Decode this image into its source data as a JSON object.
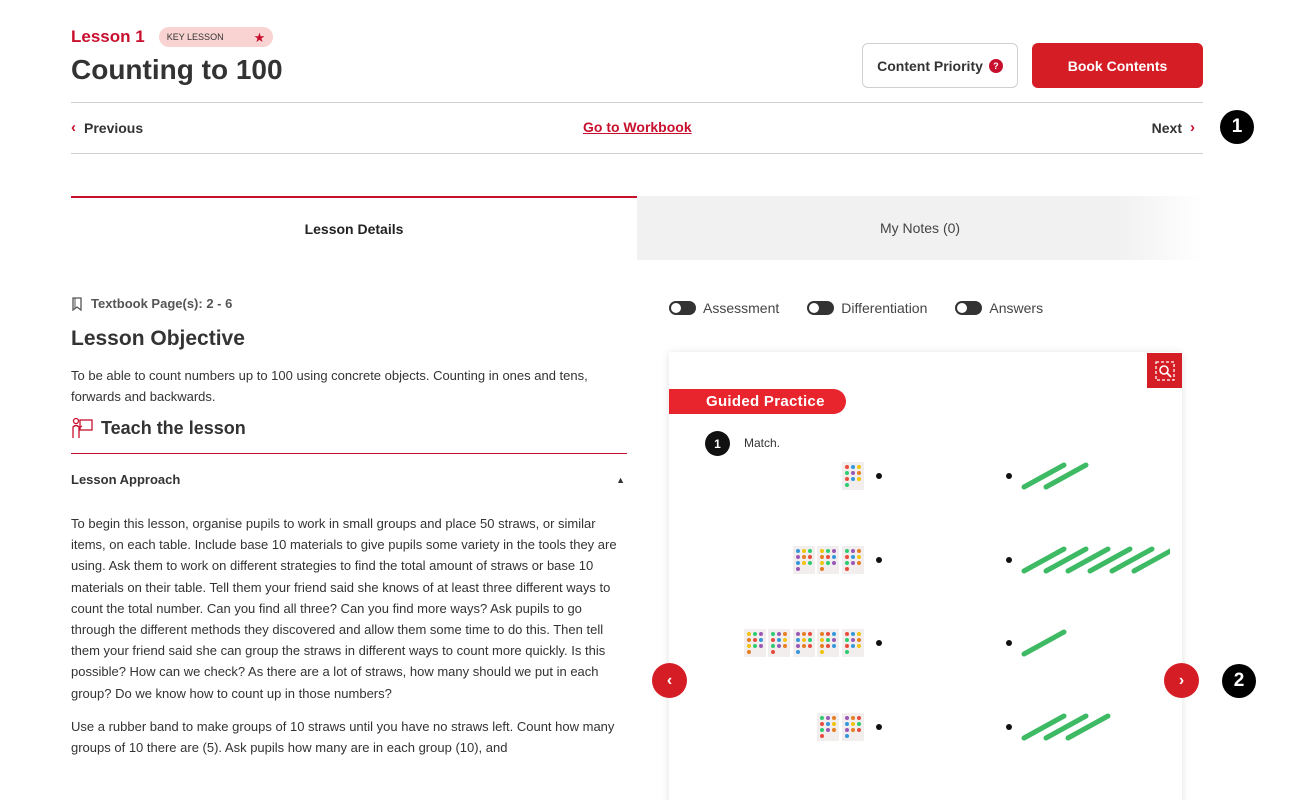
{
  "header": {
    "lesson_label": "Lesson 1",
    "badge_label": "KEY LESSON",
    "title": "Counting to 100",
    "content_priority_label": "Content Priority",
    "book_contents_label": "Book Contents"
  },
  "nav": {
    "previous_label": "Previous",
    "workbook_label": "Go to Workbook",
    "next_label": "Next"
  },
  "callouts": [
    "1",
    "2"
  ],
  "tabs": [
    {
      "label": "Lesson Details",
      "active": true
    },
    {
      "label": "My Notes (0)",
      "active": false
    }
  ],
  "details": {
    "textbook_pages": "Textbook Page(s): 2 - 6",
    "objective_title": "Lesson Objective",
    "objective_text": "To be able to count numbers up to 100 using concrete objects. Counting in ones and tens, forwards and backwards.",
    "teach_label": "Teach the lesson",
    "approach_label": "Lesson Approach",
    "approach_para1": "To begin this lesson, organise pupils to work in small groups and place 50 straws, or similar items, on each table. Include base 10 materials to give pupils some variety in the tools they are using. Ask them to work on different strategies to find the total amount of straws or base 10 materials on their table. Tell them your friend said she knows of at least three different ways to count the total number. Can you find all three? Can you find more ways? Ask pupils to go through the different methods they discovered and allow them some time to do this. Then tell them your friend said she can group the straws in different ways to count more quickly. Is this possible? How can we check? As there are a lot of straws, how many should we put in each group? Do we know how to count up in those numbers?",
    "approach_para2": "Use a rubber band to make groups of 10 straws until you have no straws left. Count how many groups of 10 there are (5). Ask pupils how many are in each group (10), and"
  },
  "toggles": [
    {
      "label": "Assessment",
      "on": false
    },
    {
      "label": "Differentiation",
      "on": false
    },
    {
      "label": "Answers",
      "on": false
    }
  ],
  "practice": {
    "banner": "Guided Practice",
    "question_number": "1",
    "instruction": "Match."
  },
  "icons": {
    "prev": "chevron-left-icon",
    "next": "chevron-right-icon",
    "help": "question-icon",
    "star": "star-icon",
    "book": "bookmark-icon",
    "teach": "teacher-board-icon",
    "zoom": "zoom-search-icon",
    "caret": "caret-up-icon"
  },
  "colors": {
    "accent": "#d51d25",
    "lesson_red": "#c8102e",
    "badge_bg": "#f9d3d1",
    "stick_green": "#3dba63"
  }
}
